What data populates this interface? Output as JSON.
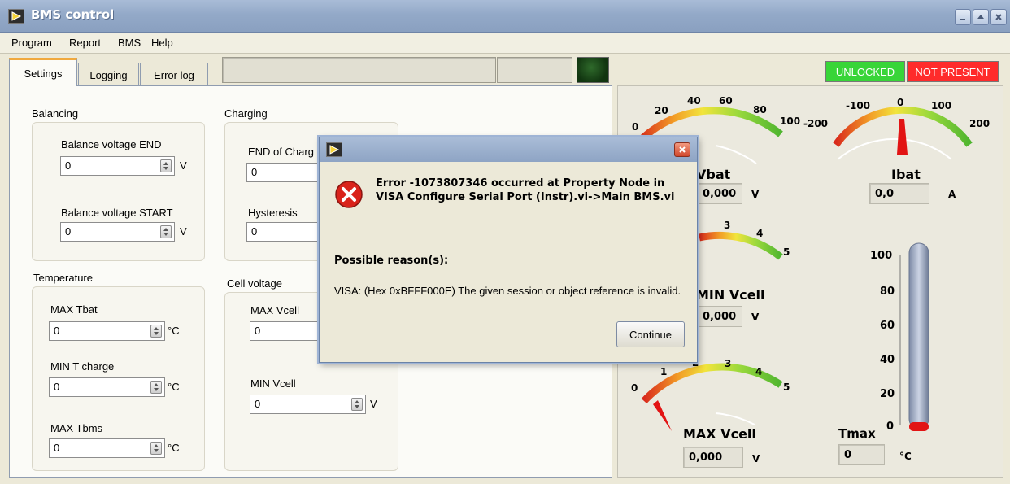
{
  "window": {
    "title": "BMS control"
  },
  "menu": {
    "items": [
      "Program",
      "Report",
      "BMS",
      "Help"
    ]
  },
  "tabs": [
    {
      "label": "Settings",
      "active": true
    },
    {
      "label": "Logging"
    },
    {
      "label": "Error log"
    }
  ],
  "status": {
    "unlocked": "UNLOCKED",
    "not_present": "NOT PRESENT",
    "led_color": "#1f4d1c"
  },
  "settings": {
    "balancing": {
      "title": "Balancing",
      "end": {
        "label": "Balance voltage END",
        "value": "0",
        "unit": "V"
      },
      "start": {
        "label": "Balance voltage START",
        "value": "0",
        "unit": "V"
      }
    },
    "charging": {
      "title": "Charging",
      "end": {
        "label": "END of Charg",
        "value": "0"
      },
      "hysteresis": {
        "label": "Hysteresis",
        "value": "0"
      }
    },
    "temperature": {
      "title": "Temperature",
      "max_tbat": {
        "label": "MAX Tbat",
        "value": "0",
        "unit": "°C"
      },
      "min_tcharge": {
        "label": "MIN T charge",
        "value": "0",
        "unit": "°C"
      },
      "max_tbms": {
        "label": "MAX Tbms",
        "value": "0",
        "unit": "°C"
      }
    },
    "cell_voltage": {
      "title": "Cell voltage",
      "max_vcell": {
        "label": "MAX Vcell",
        "value": "0"
      },
      "min_vcell": {
        "label": "MIN Vcell",
        "value": "0",
        "unit": "V"
      }
    }
  },
  "gauges": {
    "vbat": {
      "ticks": [
        "0",
        "20",
        "40",
        "60",
        "80",
        "100"
      ],
      "label": "Vbat",
      "value": "0,000",
      "unit": "V"
    },
    "ibat": {
      "ticks": [
        "-200",
        "-100",
        "0",
        "100",
        "200"
      ],
      "label": "Ibat",
      "value": "0,0",
      "unit": "A"
    },
    "min_vcell": {
      "ticks": [
        "3",
        "4",
        "5"
      ],
      "label": "MIN Vcell",
      "value": "0,000",
      "unit": "V"
    },
    "max_vcell": {
      "ticks": [
        "0",
        "1",
        "2",
        "3",
        "4",
        "5"
      ],
      "label": "MAX Vcell",
      "value": "0,000",
      "unit": "V"
    },
    "tmax": {
      "ticks": [
        "100",
        "80",
        "60",
        "40",
        "20",
        "0"
      ],
      "label": "Tmax",
      "value": "0",
      "unit": "°C"
    }
  },
  "dialog": {
    "message": "Error -1073807346 occurred at Property Node in VISA Configure Serial Port (Instr).vi->Main BMS.vi",
    "reason_title": "Possible reason(s):",
    "reason": "VISA:  (Hex 0xBFFF000E) The given session or object reference is invalid.",
    "button": "Continue"
  }
}
